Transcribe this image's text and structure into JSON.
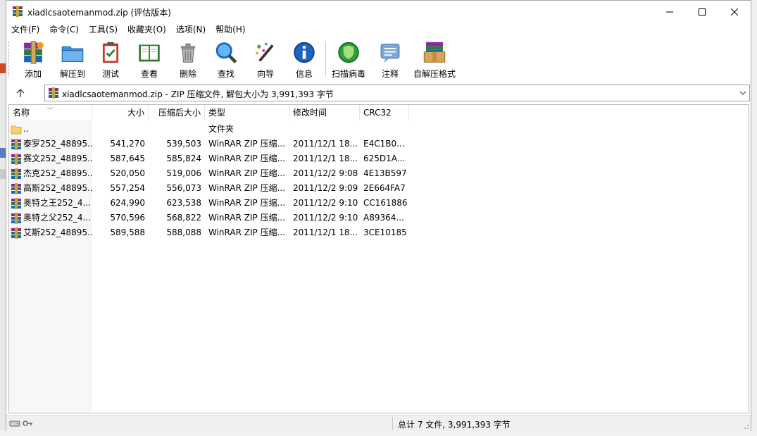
{
  "window": {
    "title": "xiadlcsaotemanmod.zip (评估版本)",
    "controls": {
      "minimize": "—",
      "maximize": "☐",
      "close": "✕"
    }
  },
  "menu": [
    "文件(F)",
    "命令(C)",
    "工具(S)",
    "收藏夹(O)",
    "选项(N)",
    "帮助(H)"
  ],
  "toolbar": [
    {
      "label": "添加",
      "icon": "add-archive-icon"
    },
    {
      "label": "解压到",
      "icon": "extract-folder-icon"
    },
    {
      "label": "测试",
      "icon": "test-clipboard-icon"
    },
    {
      "label": "查看",
      "icon": "view-book-icon"
    },
    {
      "label": "删除",
      "icon": "trash-can-icon"
    },
    {
      "label": "查找",
      "icon": "magnifier-icon"
    },
    {
      "label": "向导",
      "icon": "wizard-wand-icon"
    },
    {
      "label": "信息",
      "icon": "info-icon"
    },
    {
      "label": "扫描病毒",
      "icon": "virus-scan-shield-icon"
    },
    {
      "label": "注释",
      "icon": "comment-icon"
    },
    {
      "label": "自解压格式",
      "icon": "sfx-box-icon"
    }
  ],
  "address": {
    "text": "xiadlcsaotemanmod.zip - ZIP 压缩文件, 解包大小为 3,991,393 字节"
  },
  "columns": {
    "name": "名称",
    "size": "大小",
    "packed": "压缩后大小",
    "type": "类型",
    "modified": "修改时间",
    "crc": "CRC32"
  },
  "files": [
    {
      "name": "..",
      "size": "",
      "packed": "",
      "type": "文件夹",
      "modified": "",
      "crc": "",
      "icon": "folder-icon"
    },
    {
      "name": "泰罗252_48895...",
      "size": "541,270",
      "packed": "539,503",
      "type": "WinRAR ZIP 压缩...",
      "modified": "2011/12/1 18...",
      "crc": "E4C1B0...",
      "icon": "winrar-zip-icon"
    },
    {
      "name": "赛文252_48895...",
      "size": "587,645",
      "packed": "585,824",
      "type": "WinRAR ZIP 压缩...",
      "modified": "2011/12/1 18...",
      "crc": "625D1A...",
      "icon": "winrar-zip-icon"
    },
    {
      "name": "杰克252_48895...",
      "size": "520,050",
      "packed": "519,006",
      "type": "WinRAR ZIP 压缩...",
      "modified": "2011/12/2 9:08",
      "crc": "4E13B597",
      "icon": "winrar-zip-icon"
    },
    {
      "name": "高斯252_48895...",
      "size": "557,254",
      "packed": "556,073",
      "type": "WinRAR ZIP 压缩...",
      "modified": "2011/12/2 9:09",
      "crc": "2E664FA7",
      "icon": "winrar-zip-icon"
    },
    {
      "name": "奥特之王252_4...",
      "size": "624,990",
      "packed": "623,538",
      "type": "WinRAR ZIP 压缩...",
      "modified": "2011/12/2 9:10",
      "crc": "CC161886",
      "icon": "winrar-zip-icon"
    },
    {
      "name": "奥特之父252_4...",
      "size": "570,596",
      "packed": "568,822",
      "type": "WinRAR ZIP 压缩...",
      "modified": "2011/12/2 9:10",
      "crc": "A89364...",
      "icon": "winrar-zip-icon"
    },
    {
      "name": "艾斯252_48895...",
      "size": "589,588",
      "packed": "588,088",
      "type": "WinRAR ZIP 压缩...",
      "modified": "2011/12/1 18...",
      "crc": "3CE10185",
      "icon": "winrar-zip-icon"
    }
  ],
  "status": {
    "summary": "总计 7 文件, 3,991,393 字节"
  }
}
